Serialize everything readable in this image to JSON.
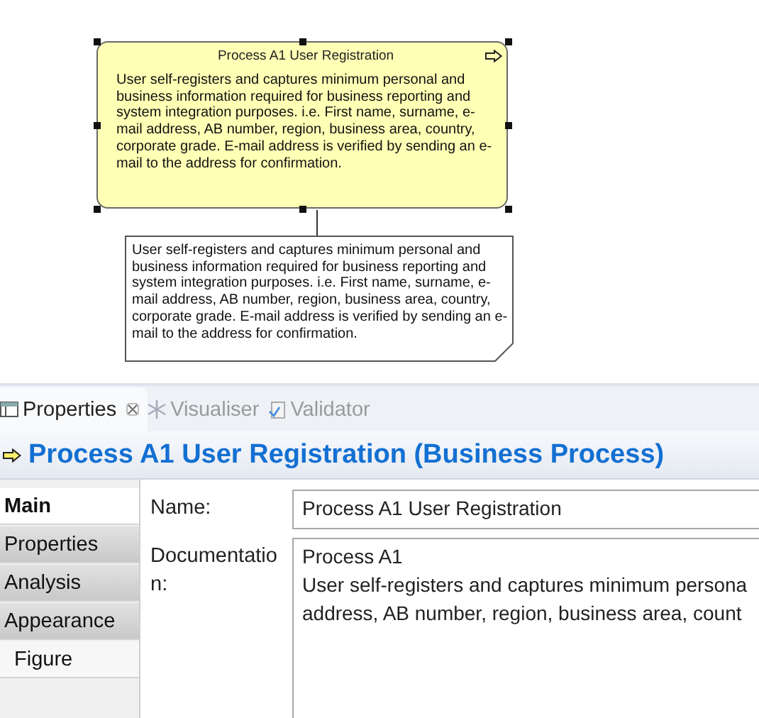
{
  "diagram": {
    "process": {
      "title": "Process A1 User Registration",
      "description": "User self-registers and captures minimum personal and business information required for business reporting and system integration purposes. i.e. First name, surname, e-mail address, AB number, region, business area, country, corporate grade. E-mail address is verified by sending an e-mail to the address for confirmation.",
      "selected": true
    },
    "note": {
      "text": "User self-registers and captures minimum personal and business information required for business reporting and system integration purposes. i.e. First name, surname, e-mail address, AB number, region, business area, country, corporate grade. E-mail address is verified by sending an e-mail to the address for confirmation."
    }
  },
  "view_tabs": [
    {
      "label": "Properties",
      "selected": true,
      "closable": true
    },
    {
      "label": "Visualiser",
      "selected": false,
      "closable": false
    },
    {
      "label": "Validator",
      "selected": false,
      "closable": false
    }
  ],
  "header": {
    "title": "Process A1 User Registration (Business Process)"
  },
  "section_tabs": [
    {
      "label": "Main",
      "selected": true,
      "kind": "tab"
    },
    {
      "label": "Properties",
      "selected": false,
      "kind": "tab"
    },
    {
      "label": "Analysis",
      "selected": false,
      "kind": "tab"
    },
    {
      "label": "Appearance",
      "selected": false,
      "kind": "tab"
    },
    {
      "label": "Figure",
      "selected": false,
      "kind": "subtab"
    }
  ],
  "fields": [
    {
      "label_lines": [
        "Name:"
      ],
      "kind": "line",
      "value_lines": [
        "Process A1 User Registration"
      ]
    },
    {
      "label_lines": [
        "Documentatio",
        "n:"
      ],
      "kind": "area",
      "value_lines": [
        "Process A1",
        "User self-registers and captures minimum persona",
        "address, AB number, region, business area, count"
      ]
    }
  ]
}
